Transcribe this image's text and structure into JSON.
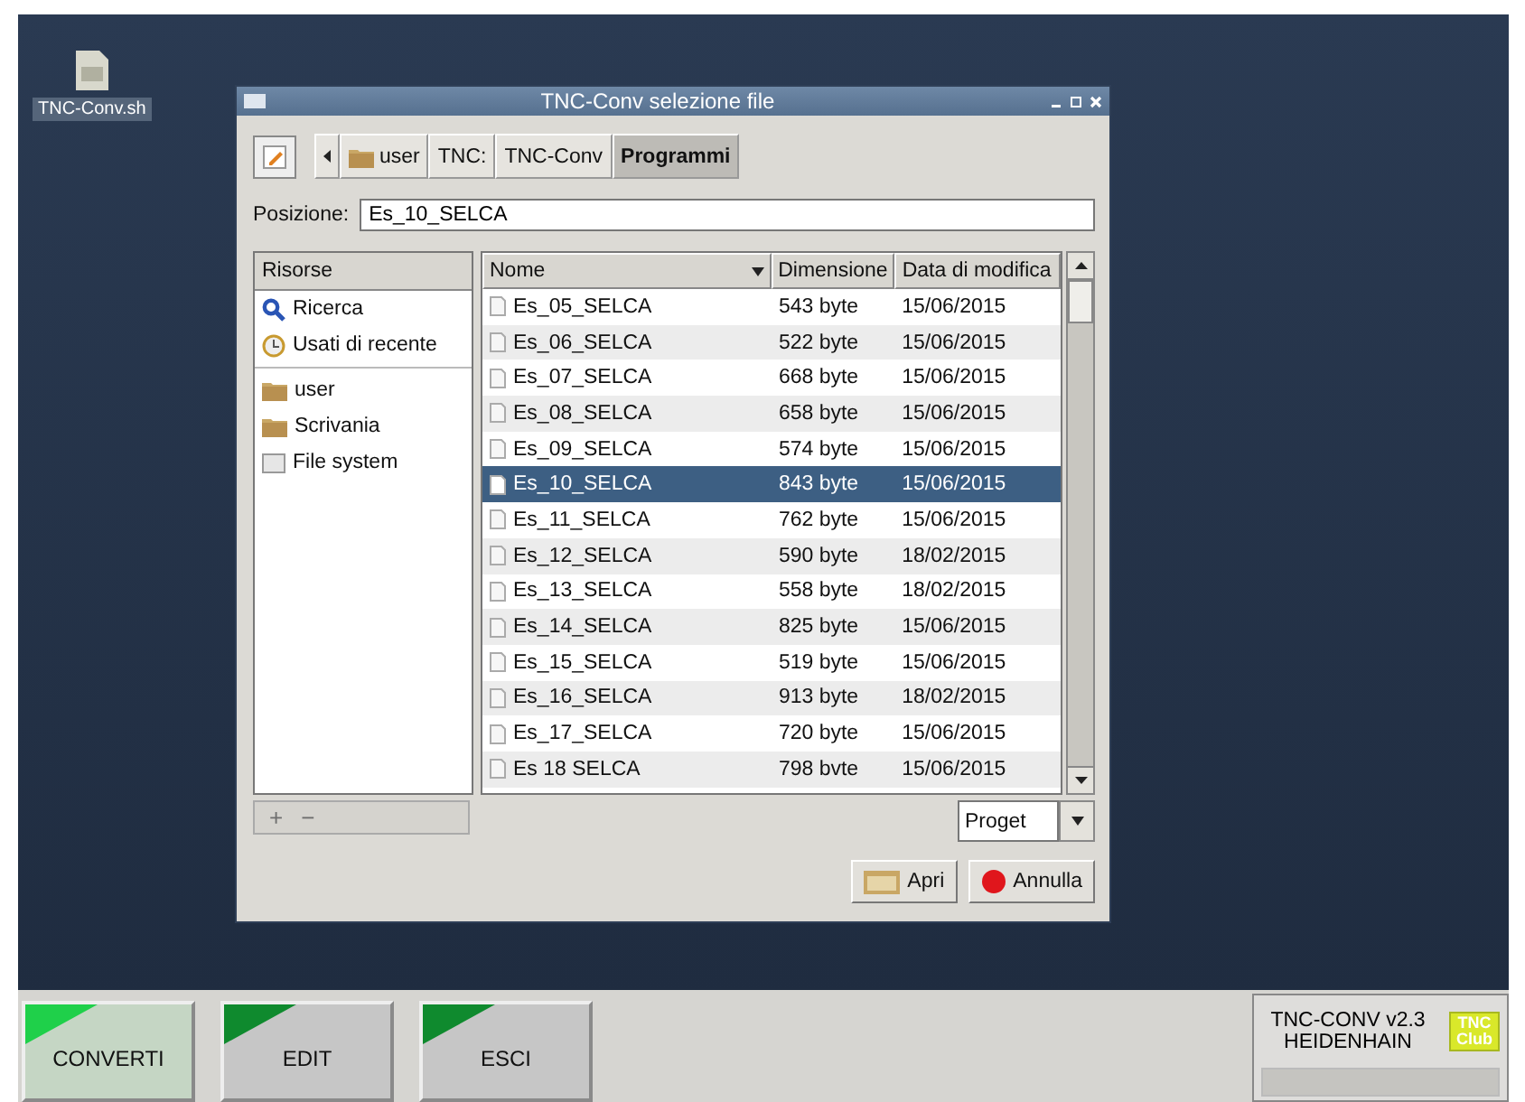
{
  "desktop_icon": {
    "label": "TNC-Conv.sh"
  },
  "dialog": {
    "title": "TNC-Conv selezione file",
    "path_buttons": [
      {
        "label": "user",
        "kind": "folder",
        "selected": false
      },
      {
        "label": "TNC:",
        "kind": "plain",
        "selected": false
      },
      {
        "label": "TNC-Conv",
        "kind": "plain",
        "selected": false
      },
      {
        "label": "Programmi",
        "kind": "plain",
        "selected": true
      }
    ],
    "location": {
      "label": "Posizione:",
      "value": "Es_10_SELCA"
    },
    "places": {
      "header": "Risorse",
      "groups": [
        [
          {
            "label": "Ricerca",
            "kind": "search"
          },
          {
            "label": "Usati di recente",
            "kind": "recent"
          }
        ],
        [
          {
            "label": "user",
            "kind": "folder"
          },
          {
            "label": "Scrivania",
            "kind": "folder"
          },
          {
            "label": "File system",
            "kind": "drive"
          }
        ]
      ]
    },
    "place_buttons": [
      {
        "label": "+",
        "disabled": true
      },
      {
        "label": "−",
        "disabled": true
      }
    ],
    "files": {
      "columns": [
        "Nome",
        "Dimensione",
        "Data di modifica"
      ],
      "rows": [
        {
          "name": "Es_05_SELCA",
          "size": "543 byte",
          "date": "15/06/2015",
          "selected": false
        },
        {
          "name": "Es_06_SELCA",
          "size": "522 byte",
          "date": "15/06/2015",
          "selected": false
        },
        {
          "name": "Es_07_SELCA",
          "size": "668 byte",
          "date": "15/06/2015",
          "selected": false
        },
        {
          "name": "Es_08_SELCA",
          "size": "658 byte",
          "date": "15/06/2015",
          "selected": false
        },
        {
          "name": "Es_09_SELCA",
          "size": "574 byte",
          "date": "15/06/2015",
          "selected": false
        },
        {
          "name": "Es_10_SELCA",
          "size": "843 byte",
          "date": "15/06/2015",
          "selected": true
        },
        {
          "name": "Es_11_SELCA",
          "size": "762 byte",
          "date": "15/06/2015",
          "selected": false
        },
        {
          "name": "Es_12_SELCA",
          "size": "590 byte",
          "date": "18/02/2015",
          "selected": false
        },
        {
          "name": "Es_13_SELCA",
          "size": "558 byte",
          "date": "18/02/2015",
          "selected": false
        },
        {
          "name": "Es_14_SELCA",
          "size": "825 byte",
          "date": "15/06/2015",
          "selected": false
        },
        {
          "name": "Es_15_SELCA",
          "size": "519 byte",
          "date": "15/06/2015",
          "selected": false
        },
        {
          "name": "Es_16_SELCA",
          "size": "913 byte",
          "date": "18/02/2015",
          "selected": false
        },
        {
          "name": "Es_17_SELCA",
          "size": "720 byte",
          "date": "15/06/2015",
          "selected": false
        },
        {
          "name": "Es 18 SELCA",
          "size": "798 bvte",
          "date": "15/06/2015",
          "selected": false
        }
      ]
    },
    "filter": {
      "value": "Proget"
    },
    "buttons": [
      {
        "label": "Apri",
        "kind": "open"
      },
      {
        "label": "Annulla",
        "kind": "cancel"
      }
    ]
  },
  "softkeys": [
    {
      "label": "CONVERTI",
      "selected": true
    },
    {
      "label": "EDIT",
      "selected": false
    },
    {
      "label": "ESCI",
      "selected": false
    }
  ],
  "info": {
    "lines": [
      "TNC-CONV v2.3",
      "HEIDENHAIN"
    ],
    "logo": [
      "TNC",
      "Club"
    ]
  }
}
